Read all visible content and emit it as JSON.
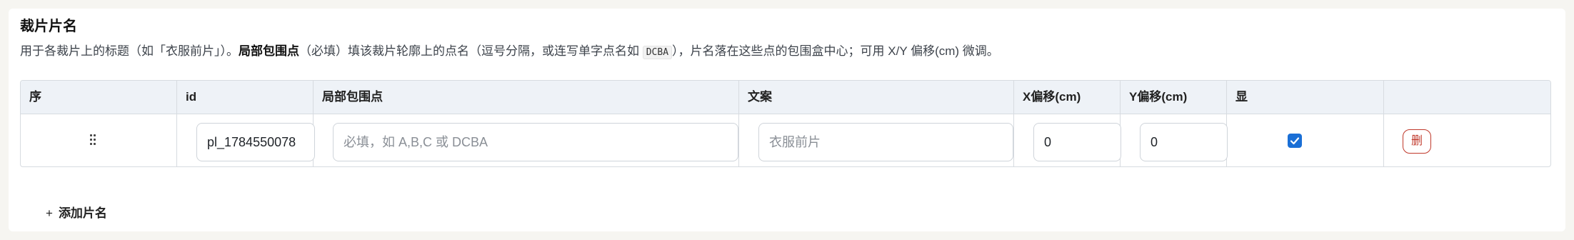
{
  "section": {
    "title": "裁片片名",
    "desc": {
      "part1": "用于各裁片上的标题（如「衣服前片」）。",
      "bold": "局部包围点",
      "part2": "（必填）填该裁片轮廓上的点名（逗号分隔，或连写单字点名如 ",
      "code": "DCBA",
      "part3": "），片名落在这些点的包围盒中心；可用 X/Y 偏移(cm) 微调。"
    }
  },
  "table": {
    "headers": {
      "seq": "序",
      "id": "id",
      "points": "局部包围点",
      "text": "文案",
      "x_offset": "X偏移(cm)",
      "y_offset": "Y偏移(cm)",
      "show": "显",
      "action": ""
    },
    "rows": [
      {
        "drag_icon": "drag-handle-icon",
        "id_value": "pl_1784550078",
        "points_value": "",
        "points_placeholder": "必填，如 A,B,C 或 DCBA",
        "text_value": "",
        "text_placeholder": "衣服前片",
        "x_value": "0",
        "y_value": "0",
        "show_checked": true,
        "delete_label": "删"
      }
    ]
  },
  "add_button": {
    "icon": "+",
    "label": "添加片名"
  },
  "colors": {
    "accent": "#1a6fd6",
    "danger": "#c0392b",
    "header_bg": "#eef2f7",
    "page_bg": "#f6f5f1"
  }
}
